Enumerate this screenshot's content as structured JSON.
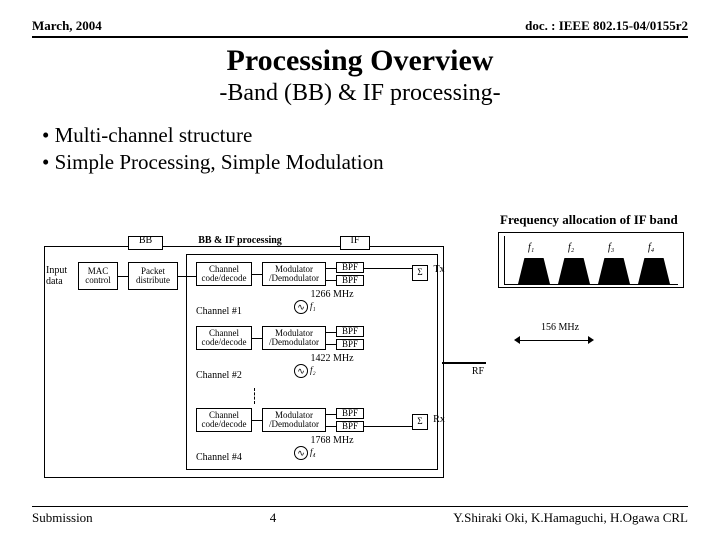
{
  "header": {
    "date": "March, 2004",
    "docref": "doc. : IEEE 802.15-04/0155r2"
  },
  "title": "Processing Overview",
  "subtitle": "-Band (BB) & IF processing-",
  "bullets": [
    "• Multi-channel structure",
    "• Simple Processing,  Simple Modulation"
  ],
  "freq_caption": "Frequency allocation of IF band",
  "diagram": {
    "bb_if_heading": "BB & IF processing",
    "sec_bb": "BB",
    "sec_if": "IF",
    "input_data": "Input\ndata",
    "mac": "MAC\ncontrol",
    "packet": "Packet\ndistribute",
    "chcode": "Channel\ncode/decode",
    "moddemod": "Modulator\n/Demodulator",
    "bpf": "BPF",
    "ch1": "Channel #1",
    "ch2": "Channel #2",
    "ch4": "Channel #4",
    "mhz1": "1266 MHz",
    "mhz2": "1422 MHz",
    "mhz3": "1768 MHz",
    "f1": "f₁",
    "f2": "f₂",
    "f4": "f₄",
    "tx": "Tx",
    "rx": "Rx",
    "sigma": "Σ",
    "if_scale": "156 MHz",
    "rf": "RF",
    "freq_labels": [
      "f₁",
      "f₂",
      "f₃",
      "f₄"
    ]
  },
  "footer": {
    "left": "Submission",
    "center": "4",
    "right": "Y.Shiraki  Oki, K.Hamaguchi, H.Ogawa CRL"
  }
}
